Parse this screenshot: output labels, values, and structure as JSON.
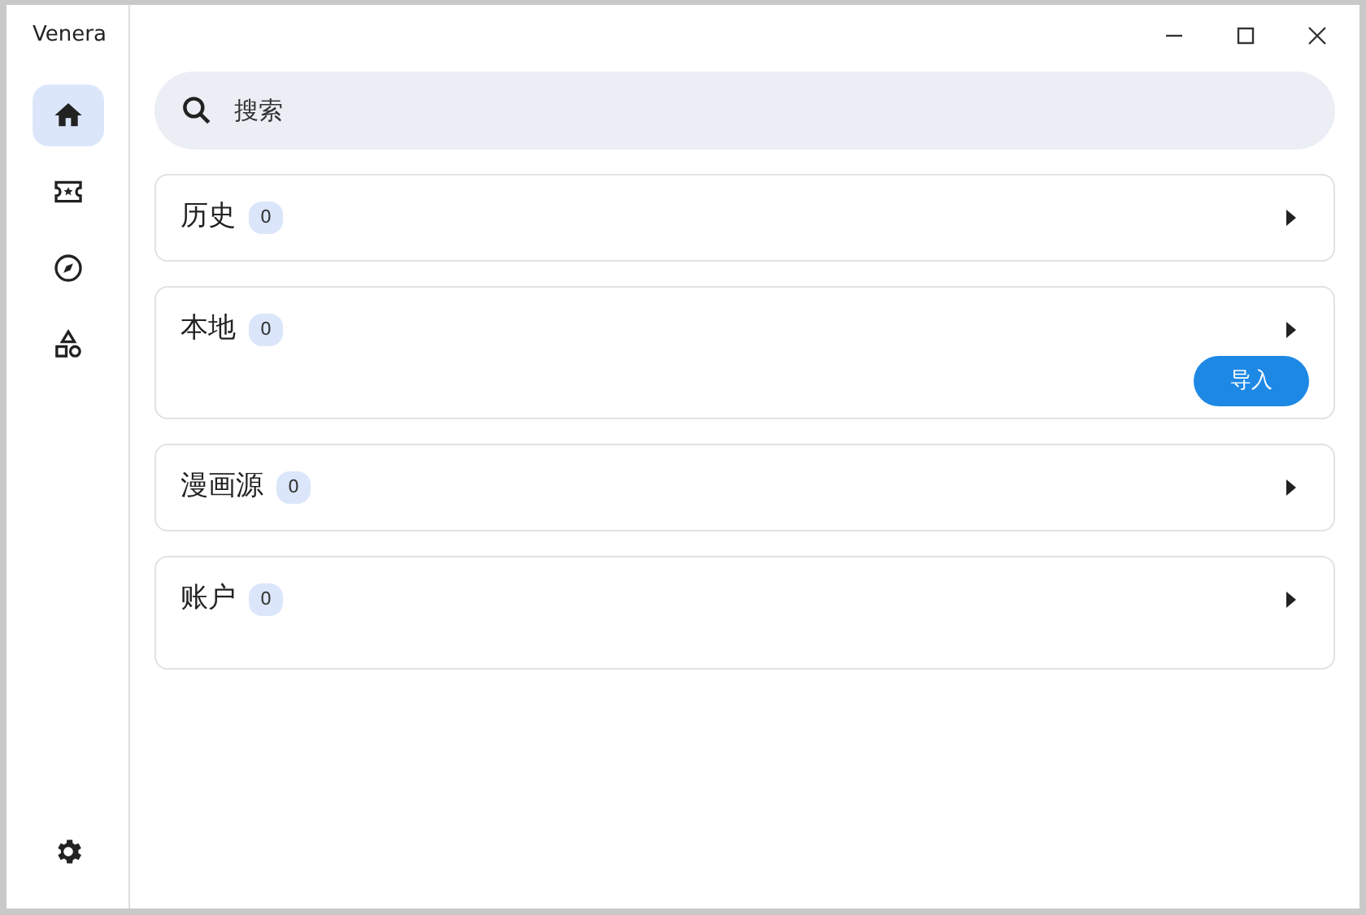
{
  "window": {
    "title": "Venera"
  },
  "nav": [
    {
      "selected": true
    },
    {
      "selected": false
    },
    {
      "selected": false
    },
    {
      "selected": false
    }
  ],
  "search": {
    "placeholder": "搜索"
  },
  "sections": [
    {
      "title": "历史",
      "count": "0"
    },
    {
      "title": "本地",
      "count": "0",
      "action": "导入"
    },
    {
      "title": "漫画源",
      "count": "0"
    },
    {
      "title": "账户",
      "count": "0"
    }
  ]
}
